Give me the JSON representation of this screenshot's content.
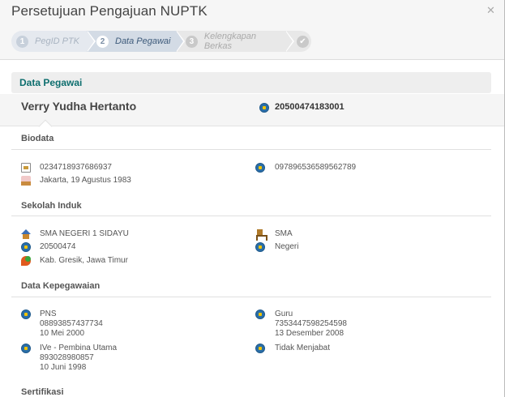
{
  "window": {
    "title": "Persetujuan Pengajuan NUPTK"
  },
  "steps": [
    {
      "num": "1",
      "label": "PegID PTK"
    },
    {
      "num": "2",
      "label": "Data Pegawai"
    },
    {
      "num": "3",
      "label": "Kelengkapan Berkas"
    },
    {
      "num": "✔",
      "label": ""
    }
  ],
  "section": {
    "title": "Data Pegawai"
  },
  "profile": {
    "name": "Verry Yudha Hertanto",
    "nuptk": "20500474183001"
  },
  "biodata": {
    "heading": "Biodata",
    "id_number": "0234718937686937",
    "birth": "Jakarta, 19 Agustus 1983",
    "second_id": "097896536589562789"
  },
  "sekolah": {
    "heading": "Sekolah Induk",
    "name": "SMA NEGERI 1 SIDAYU",
    "level": "SMA",
    "npsn": "20500474",
    "status": "Negeri",
    "location": "Kab. Gresik, Jawa Timur"
  },
  "kepegawaian": {
    "heading": "Data Kepegawaian",
    "status": "PNS",
    "status_no": "08893857437734",
    "status_date": "10 Mei 2000",
    "jenis": "Guru",
    "jenis_no": "7353447598254598",
    "jenis_date": "13 Desember 2008",
    "golongan": "IVe - Pembina Utama",
    "golongan_no": "893028980857",
    "golongan_date": "10 Juni 1998",
    "jabatan": "Tidak Menjabat"
  },
  "sertifikasi": {
    "heading": "Sertifikasi"
  },
  "icons": {
    "close": "close-icon",
    "tutwuri": "tutwuri-logo-icon",
    "card": "id-card-icon",
    "cake": "birthday-cake-icon",
    "school": "school-house-icon",
    "chair": "chair-icon",
    "pin": "map-pin-icon"
  }
}
